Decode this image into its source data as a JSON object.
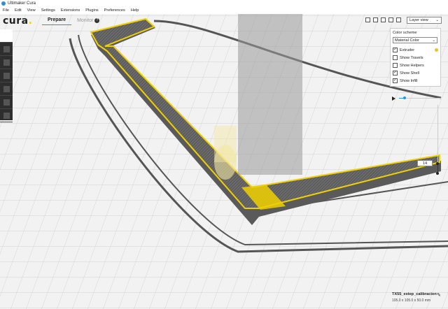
{
  "window": {
    "title": "Ultimaker Cura"
  },
  "menu": [
    "File",
    "Edit",
    "View",
    "Settings",
    "Extensions",
    "Plugins",
    "Preferences",
    "Help"
  ],
  "logo": {
    "text": "cura"
  },
  "tabs": [
    {
      "label": "Prepare",
      "active": true
    },
    {
      "label": "Monitor",
      "active": false
    }
  ],
  "view_mode": {
    "selected": "Layer view"
  },
  "panel": {
    "color_scheme_label": "Color scheme",
    "color_scheme_value": "Material Color",
    "options": [
      {
        "label": "Extruder",
        "checked": true
      },
      {
        "label": "Show Travels",
        "checked": false
      },
      {
        "label": "Show Helpers",
        "checked": false
      },
      {
        "label": "Show Shell",
        "checked": true
      },
      {
        "label": "Show Infill",
        "checked": true
      }
    ],
    "extruder_color": "#f0c020"
  },
  "layer": {
    "current": "14"
  },
  "model": {
    "name": "TX55_estep_calibracion",
    "dimensions": "105.0 x 105.0 x 50.0 mm"
  },
  "colors": {
    "accent": "#1c9bd8",
    "shell": "#f0d000",
    "infill": "#555555"
  }
}
